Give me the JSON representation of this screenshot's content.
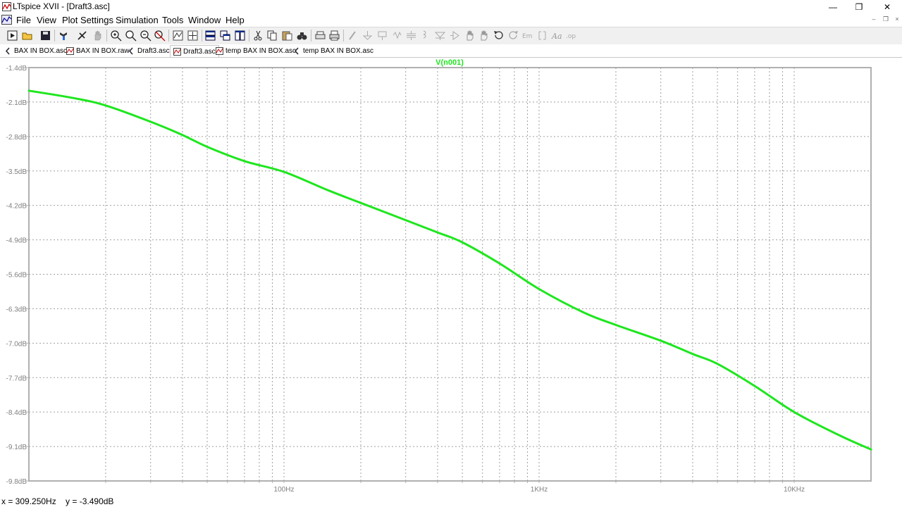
{
  "window": {
    "title": "LTspice XVII - [Draft3.asc]",
    "minimize": "—",
    "restore": "❐",
    "close": "✕"
  },
  "menu": {
    "items": [
      "File",
      "View",
      "Plot Settings",
      "Simulation",
      "Tools",
      "Window",
      "Help"
    ]
  },
  "toolbar": {
    "icons": [
      "run-icon",
      "open-icon",
      "save-icon",
      "control-panel-icon",
      "halt-icon",
      "pan-hand-icon",
      "zoom-in-icon",
      "zoom-area-icon",
      "zoom-out-icon",
      "zoom-cancel-icon",
      "autorange-icon",
      "mark-icon",
      "tile-horizontal-icon",
      "cascade-icon",
      "tile-vertical-icon",
      "cut-icon",
      "copy-icon",
      "paste-icon",
      "find-icon",
      "print-setup-icon",
      "print-icon",
      "wire-icon",
      "ground-icon",
      "label-icon",
      "resistor-icon",
      "capacitor-icon",
      "inductor-icon",
      "diode-icon",
      "component-icon",
      "move-icon",
      "drag-icon",
      "undo-icon",
      "redo-icon",
      "rotate-icon",
      "mirror-icon",
      "text-icon",
      "spice-directive-icon"
    ]
  },
  "tabs": [
    {
      "label": "BAX IN BOX.asc",
      "icon": "schematic-icon",
      "active": false
    },
    {
      "label": "BAX IN BOX.raw",
      "icon": "waveform-icon",
      "active": false
    },
    {
      "label": "Draft3.asc",
      "icon": "schematic-icon",
      "active": false
    },
    {
      "label": "Draft3.asc",
      "icon": "waveform-icon",
      "active": true
    },
    {
      "label": "temp BAX IN BOX.asc",
      "icon": "waveform-icon",
      "active": false
    },
    {
      "label": "temp BAX IN BOX.asc",
      "icon": "schematic-icon",
      "active": false
    }
  ],
  "status": {
    "text": "x = 309.250Hz    y = -3.490dB"
  },
  "colors": {
    "trace": "#1ee61e",
    "grid": "#a0a0a0",
    "axis": "#b0b0b0",
    "tick_label": "#808080"
  },
  "chart_data": {
    "type": "line",
    "title": "V(n001)",
    "xscale": "log",
    "xlim": [
      10,
      20000
    ],
    "ylim": [
      -9.8,
      -1.4
    ],
    "yticks": [
      -1.4,
      -2.1,
      -2.8,
      -3.5,
      -4.2,
      -4.9,
      -5.6,
      -6.3,
      -7.0,
      -7.7,
      -8.4,
      -9.1,
      -9.8
    ],
    "ytick_labels": [
      "-1.4dB",
      "-2.1dB",
      "-2.8dB",
      "-3.5dB",
      "-4.2dB",
      "-4.9dB",
      "-5.6dB",
      "-6.3dB",
      "-7.0dB",
      "-7.7dB",
      "-8.4dB",
      "-9.1dB",
      "-9.8dB"
    ],
    "xtick_major": [
      100,
      1000,
      10000
    ],
    "xtick_labels": [
      "100Hz",
      "1KHz",
      "10KHz"
    ],
    "grid": true,
    "series": [
      {
        "name": "V(n001)",
        "x": [
          10,
          15,
          20,
          30,
          40,
          50,
          70,
          100,
          150,
          200,
          300,
          400,
          500,
          700,
          1000,
          1500,
          2000,
          3000,
          4000,
          5000,
          7000,
          10000,
          15000,
          20000
        ],
        "y": [
          -1.87,
          -2.02,
          -2.17,
          -2.5,
          -2.77,
          -3.01,
          -3.3,
          -3.52,
          -3.9,
          -4.15,
          -4.5,
          -4.75,
          -4.95,
          -5.38,
          -5.9,
          -6.38,
          -6.63,
          -6.95,
          -7.22,
          -7.42,
          -7.87,
          -8.4,
          -8.87,
          -9.16
        ]
      }
    ]
  }
}
